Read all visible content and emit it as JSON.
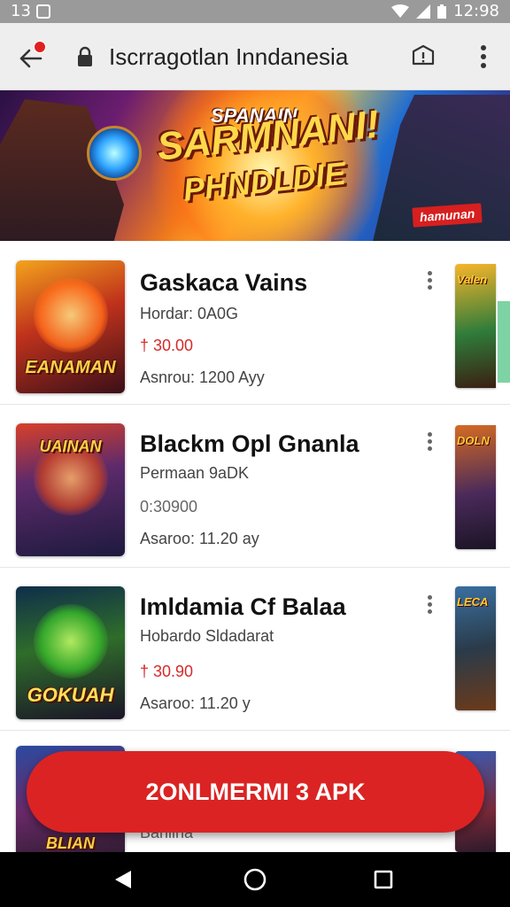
{
  "status_bar": {
    "left_text": "13",
    "time": "12:98",
    "icons": [
      "notification-box-icon",
      "wifi-icon",
      "signal-icon",
      "battery-icon"
    ]
  },
  "app_bar": {
    "title": "Iscrragotlan Inndanesia",
    "icons": [
      "back-arrow-icon",
      "lock-icon",
      "notification-shield-icon",
      "more-vert-icon"
    ]
  },
  "banner": {
    "title_top": "SPANAIN",
    "title_main": "SARMNANI!",
    "title_sub": "PHNDLDIE",
    "tag": "hamunan"
  },
  "items": [
    {
      "title": "Gaskaca Vains",
      "subtitle": "Hordar: 0A0G",
      "price": "† 30.00",
      "meta": "Asnrou: 1200 Ayy",
      "thumb_label": "EANAMAN",
      "side_label": "Valen"
    },
    {
      "title": "Blackm Opl Gnanla",
      "subtitle": "Permaan 9aDK",
      "price": "0:30900",
      "meta": "Asaroo: 11.20 ay",
      "thumb_label": "UAINAN",
      "side_label": "DOLN"
    },
    {
      "title": "Imldamia Cf Balaa",
      "subtitle": "Hobardo Sldadarat",
      "price": "† 30.90",
      "meta": "Asaroo: 11.20 y",
      "thumb_label": "GOKUAH",
      "side_label": "LECA"
    },
    {
      "title": "",
      "subtitle": "Barllina",
      "price": "",
      "meta": "",
      "thumb_label": "BLIAN",
      "side_label": ""
    }
  ],
  "cta": {
    "label": "2ONLMERMI 3 APK"
  },
  "colors": {
    "accent_red": "#db2323",
    "price_red": "#d52a2a",
    "status_bar": "#9a9a9a",
    "app_bar": "#eeeeee",
    "scroll_indicator": "#7ed3a4"
  }
}
